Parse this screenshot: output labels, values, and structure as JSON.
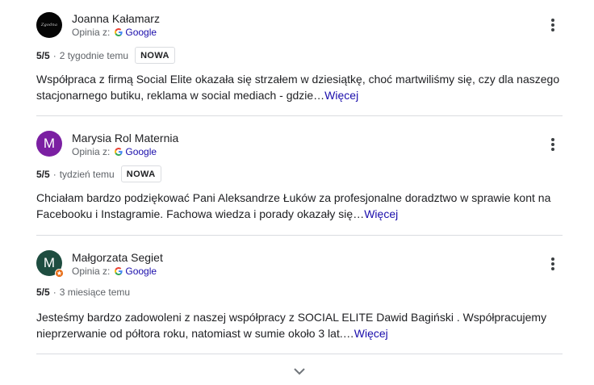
{
  "reviews": [
    {
      "name": "Joanna Kałamarz",
      "avatar_text": "Zgodna",
      "avatar_color": "#050505",
      "source_prefix": "Opinia z:",
      "source_name": "Google",
      "rating": "5/5",
      "time": "2 tygodnie temu",
      "badge": "NOWA",
      "text": "Współpraca z firmą Social Elite okazała się strzałem w dziesiątkę, choć martwiliśmy się, czy dla naszego stacjonarnego butiku, reklama w social mediach - gdzie…",
      "more": "Więcej"
    },
    {
      "name": "Marysia Rol Maternia",
      "avatar_text": "M",
      "avatar_color": "#7b1fa2",
      "source_prefix": "Opinia z:",
      "source_name": "Google",
      "rating": "5/5",
      "time": "tydzień temu",
      "badge": "NOWA",
      "text": "Chciałam bardzo podziękować Pani Aleksandrze Łuków za profesjonalne doradztwo w sprawie kont na Facebooku i Instagramie. Fachowa wiedza i porady okazały się…",
      "more": "Więcej"
    },
    {
      "name": "Małgorzata Segiet",
      "avatar_text": "M",
      "avatar_color": "#1e4d40",
      "source_prefix": "Opinia z:",
      "source_name": "Google",
      "rating": "5/5",
      "time": "3 miesiące temu",
      "text": "Jesteśmy bardzo zadowoleni z naszej współpracy z SOCIAL ELITE Dawid Bagiński . Współpracujemy nieprzerwanie od półtora roku, natomiast w sumie około 3 lat.…",
      "more": "Więcej"
    }
  ],
  "icons": {
    "menu": "more-vert-icon",
    "source": "google-g-icon",
    "expand": "chevron-down-icon",
    "local_guide": "local-guide-badge-icon"
  },
  "colors": {
    "link": "#1a0dab",
    "secondary_text": "#5f6368",
    "divider": "#dadce0",
    "local_guide_badge": "#e8711c"
  }
}
